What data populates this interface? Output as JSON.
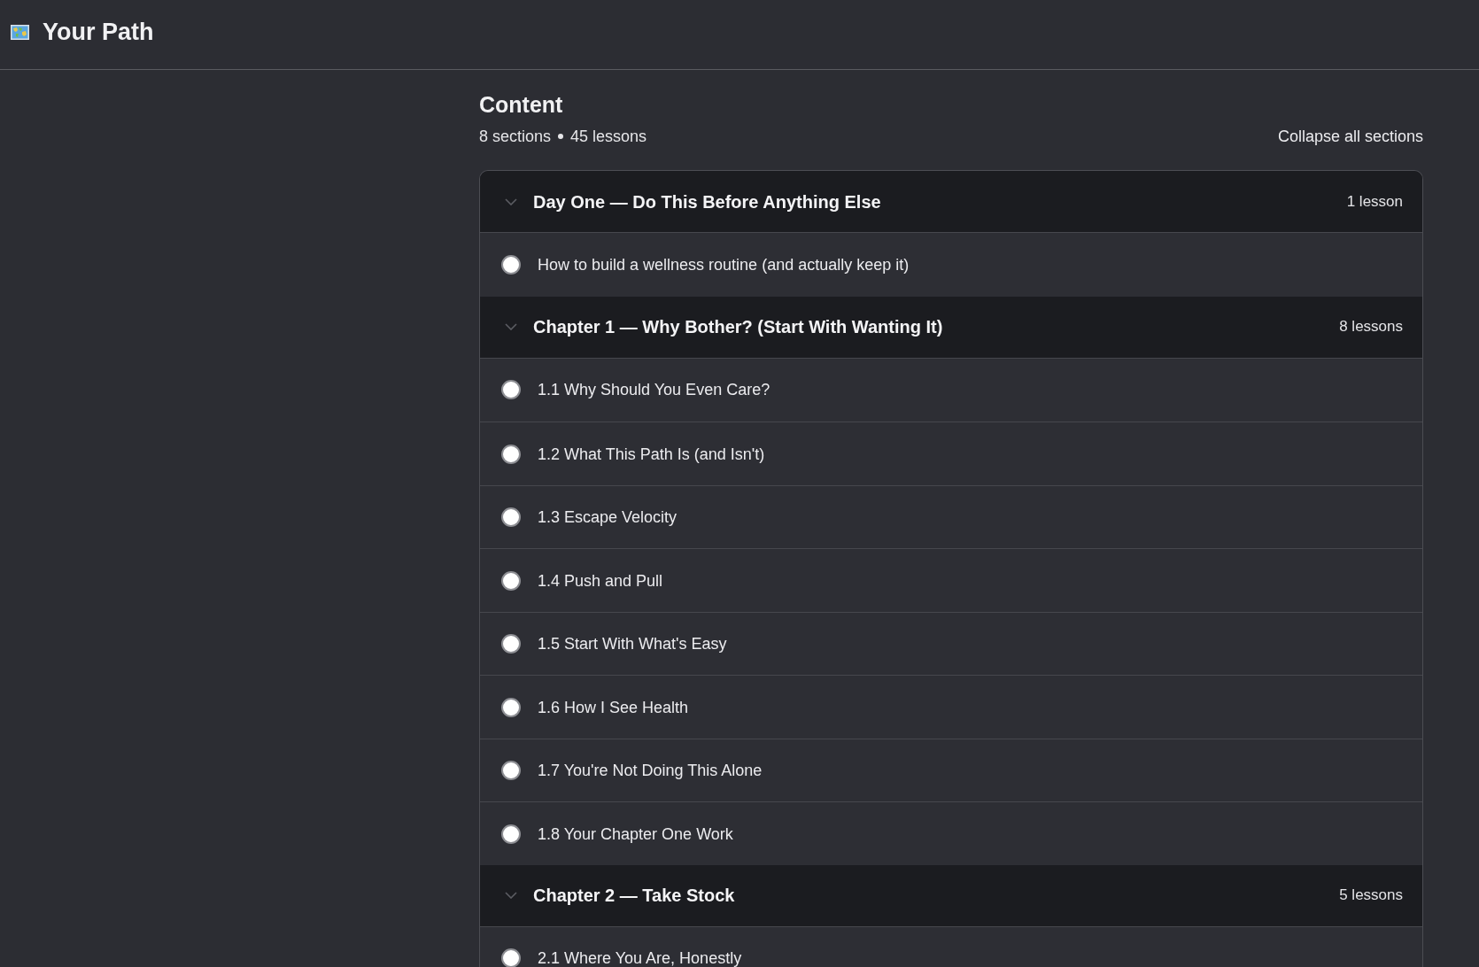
{
  "header": {
    "title": "Your Path"
  },
  "content": {
    "title": "Content",
    "sections_count": "8 sections",
    "lessons_count": "45 lessons",
    "collapse_all": "Collapse all sections"
  },
  "sections": [
    {
      "title": "Day One — Do This Before Anything Else",
      "count": "1 lesson",
      "expanded": true,
      "lessons": [
        {
          "title": "How to build a wellness routine (and actually keep it)",
          "completed": false
        }
      ]
    },
    {
      "title": "Chapter 1 — Why Bother? (Start With Wanting It)",
      "count": "8 lessons",
      "expanded": true,
      "lessons": [
        {
          "title": "1.1 Why Should You Even Care?",
          "completed": false
        },
        {
          "title": "1.2 What This Path Is (and Isn't)",
          "completed": false
        },
        {
          "title": "1.3 Escape Velocity",
          "completed": false
        },
        {
          "title": "1.4 Push and Pull",
          "completed": false
        },
        {
          "title": "1.5 Start With What's Easy",
          "completed": false
        },
        {
          "title": "1.6 How I See Health",
          "completed": false
        },
        {
          "title": "1.7 You're Not Doing This Alone",
          "completed": false
        },
        {
          "title": "1.8 Your Chapter One Work",
          "completed": false
        }
      ]
    },
    {
      "title": "Chapter 2 — Take Stock",
      "count": "5 lessons",
      "expanded": true,
      "lessons": [
        {
          "title": "2.1 Where You Are, Honestly",
          "completed": false
        }
      ]
    }
  ]
}
